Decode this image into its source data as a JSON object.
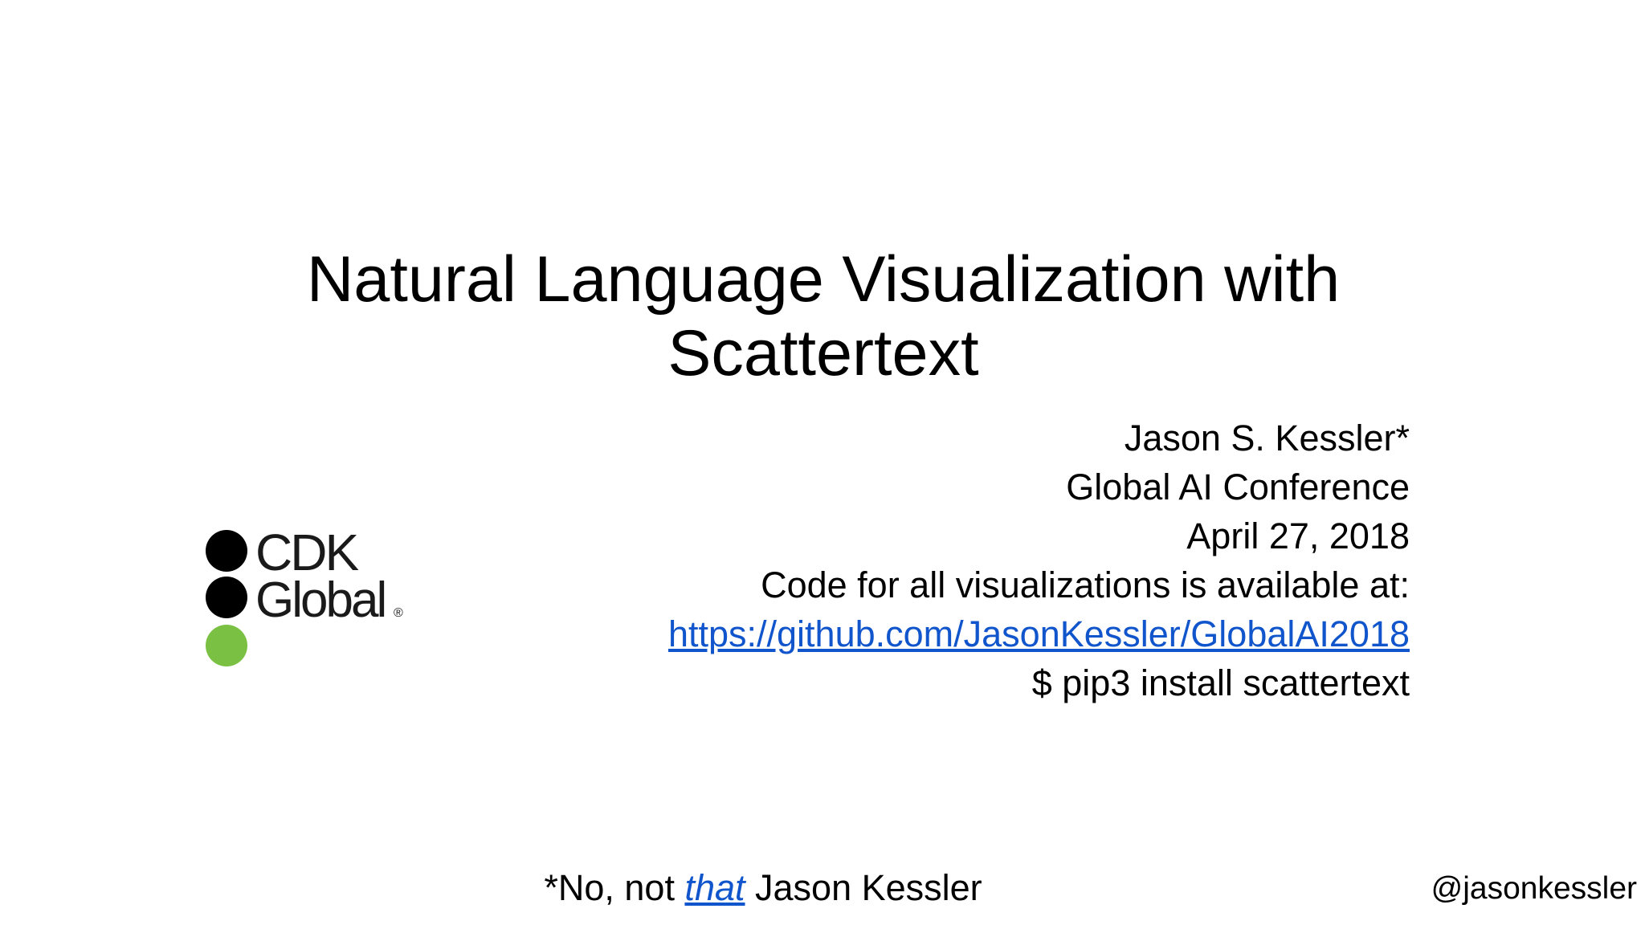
{
  "slide": {
    "title_line1": "Natural Language Visualization with",
    "title_line2": "Scattertext",
    "author": "Jason S. Kessler*",
    "conference": "Global AI Conference",
    "date": "April 27, 2018",
    "code_note": "Code for all visualizations is available at:",
    "repo_link": "https://github.com/JasonKessler/GlobalAI2018",
    "install_cmd": "$ pip3 install scattertext",
    "footnote_prefix": "*No, not ",
    "footnote_emphasis": "that",
    "footnote_suffix": " Jason Kessler",
    "handle": "@jasonkessler"
  },
  "logo": {
    "line1": "CDK",
    "line2": "Global",
    "registered_mark": "®",
    "dot_color_1": "#000000",
    "dot_color_2": "#000000",
    "dot_color_3": "#7ac143",
    "link_color": "#1155cc"
  }
}
